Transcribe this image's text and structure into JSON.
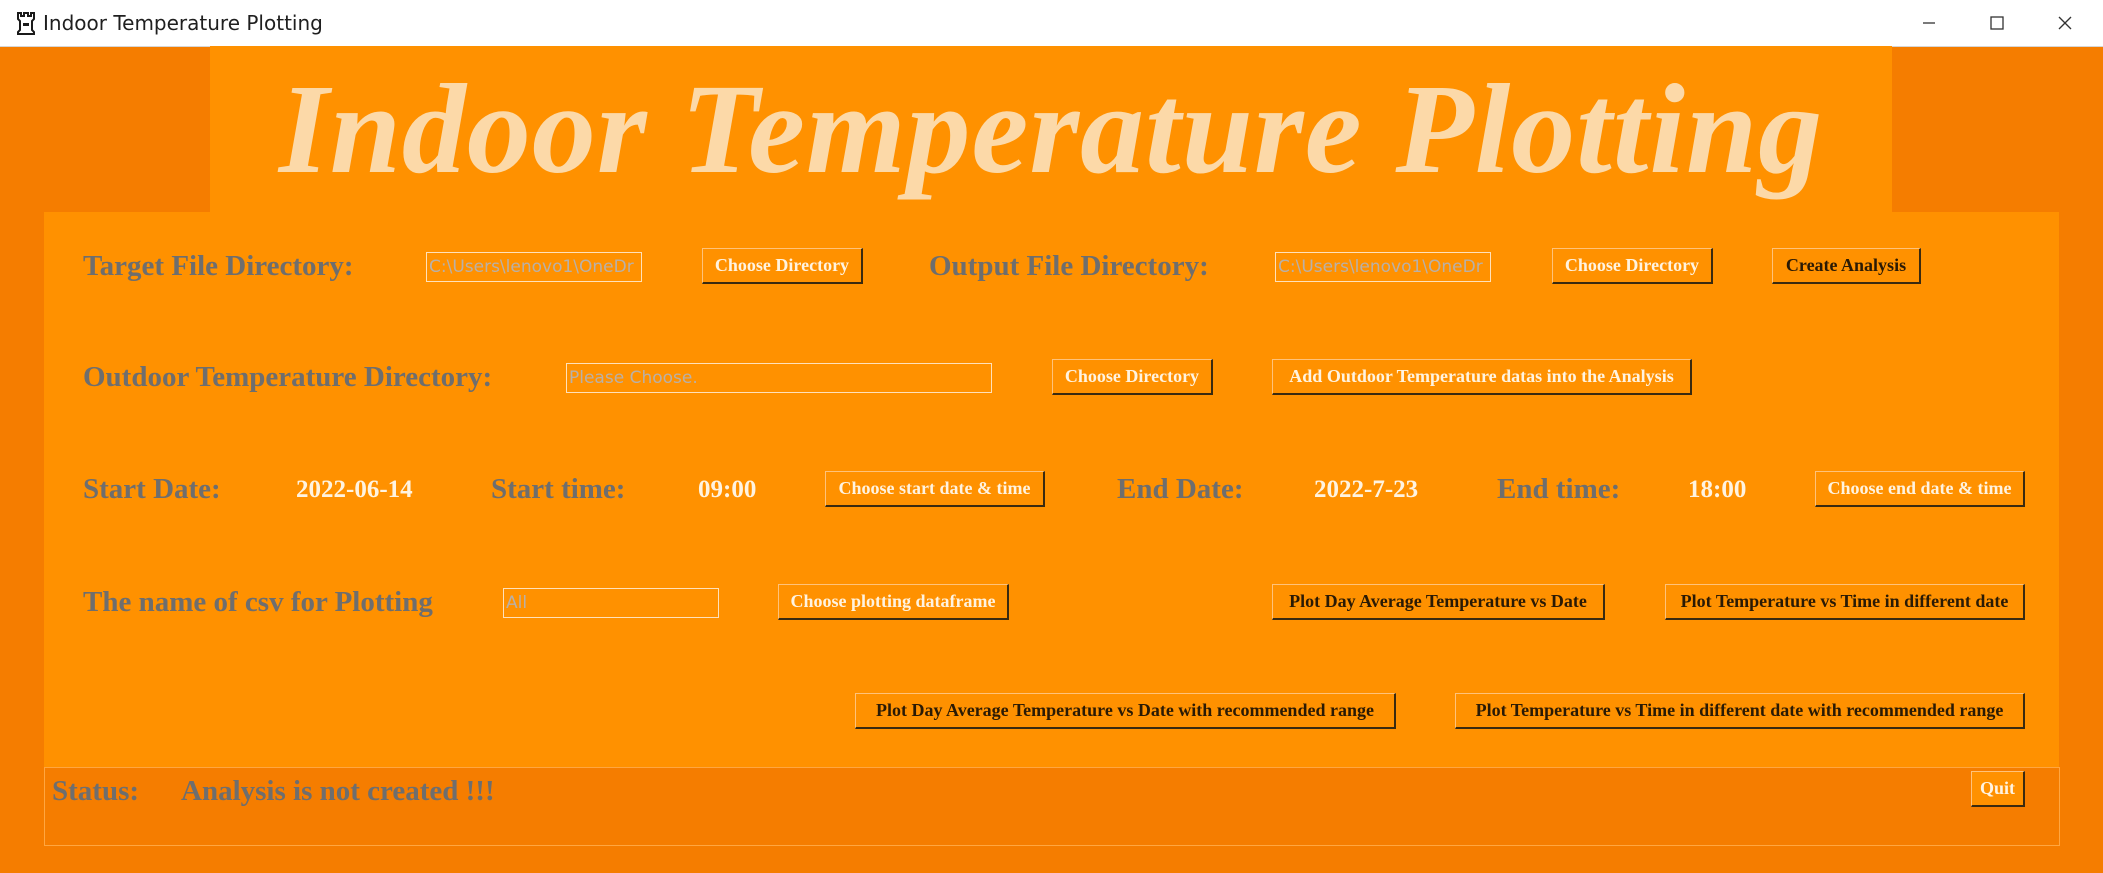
{
  "window": {
    "title": "Indoor Temperature Plotting",
    "app_icon": "castle-rook-icon",
    "controls": [
      "minimize-icon",
      "maximize-icon",
      "close-icon"
    ]
  },
  "header": {
    "title": "Indoor Temperature Plotting"
  },
  "row1": {
    "target_label": "Target File Directory:",
    "target_value": "C:\\Users\\lenovo1\\OneDr",
    "target_button": "Choose Directory",
    "output_label": "Output File Directory:",
    "output_value": "C:\\Users\\lenovo1\\OneDr",
    "output_button": "Choose Directory",
    "create_button": "Create Analysis"
  },
  "row2": {
    "outdoor_label": "Outdoor Temperature Directory:",
    "outdoor_placeholder": "Please Choose.",
    "outdoor_button": "Choose Directory",
    "add_button": "Add Outdoor Temperature datas into the Analysis"
  },
  "row3": {
    "start_date_label": "Start Date:",
    "start_date_value": "2022-06-14",
    "start_time_label": "Start time:",
    "start_time_value": "09:00",
    "start_button": "Choose start date & time",
    "end_date_label": "End Date:",
    "end_date_value": "2022-7-23",
    "end_time_label": "End time:",
    "end_time_value": "18:00",
    "end_button": "Choose end date & time"
  },
  "row4": {
    "csv_label": "The name of csv for Plotting",
    "csv_value": "All",
    "choose_df_button": "Choose plotting dataframe",
    "plot_day_avg_button": "Plot Day Average Temperature vs Date",
    "plot_temp_time_button": "Plot Temperature vs Time in different date"
  },
  "row5": {
    "plot_day_avg_range_button": "Plot Day Average Temperature vs Date with recommended range",
    "plot_temp_time_range_button": "Plot Temperature vs Time in different date with recommended range"
  },
  "status": {
    "label": "Status:",
    "message": "Analysis is not created !!!",
    "quit_button": "Quit"
  },
  "colors": {
    "background": "#f57d00",
    "panel": "#ff9100",
    "title_text": "#fcd9a8",
    "label_text": "#6e6e6e",
    "value_text": "#fff3e0"
  }
}
